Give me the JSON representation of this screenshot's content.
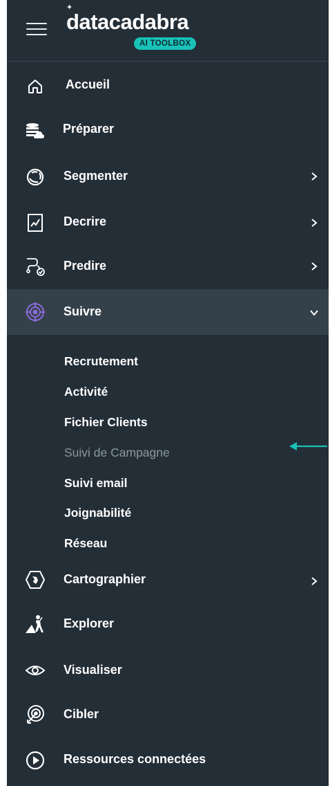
{
  "brand": {
    "name": "datacadabra",
    "badge": "AI TOOLBOX"
  },
  "nav": {
    "accueil": "Accueil",
    "preparer": "Préparer",
    "segmenter": "Segmenter",
    "decrire": "Decrire",
    "predire": "Predire",
    "suivre": "Suivre",
    "cartographier": "Cartographier",
    "explorer": "Explorer",
    "visualiser": "Visualiser",
    "cibler": "Cibler",
    "ressources": "Ressources connectées"
  },
  "suivre_submenu": [
    "Recrutement",
    "Activité",
    "Fichier Clients",
    "Suivi de Campagne",
    "Suivi email",
    "Joignabilité",
    "Réseau"
  ],
  "colors": {
    "sidebar_bg": "#232e37",
    "active_bg": "#34414b",
    "accent_teal": "#19c2b8",
    "suivre_icon": "#8a6bd9",
    "muted_text": "#8c979f"
  },
  "icons": {
    "menu": "hamburger-icon",
    "accueil": "home-icon",
    "preparer": "database-cloud-icon",
    "segmenter": "segment-ring-icon",
    "decrire": "chart-document-icon",
    "predire": "route-check-icon",
    "suivre": "target-radar-icon",
    "cartographier": "map-hex-icon",
    "explorer": "explorer-mountain-icon",
    "visualiser": "eye-icon",
    "cibler": "target-arrow-icon",
    "ressources": "play-circle-icon",
    "expand": "chevron-right-icon",
    "collapse": "chevron-down-icon",
    "pointer": "arrow-left-icon"
  }
}
